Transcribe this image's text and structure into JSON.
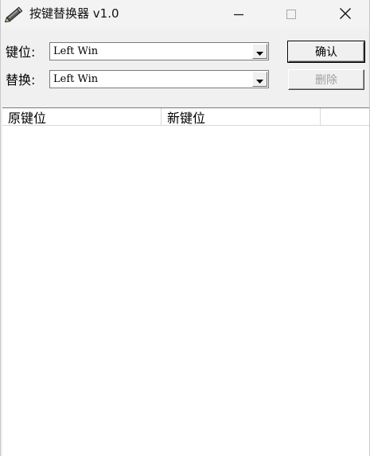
{
  "window": {
    "title": "按键替换器 v1.0",
    "icon": "pencil-icon",
    "controls": {
      "minimize": "minimize-icon",
      "maximize": "maximize-icon",
      "close": "close-icon"
    }
  },
  "form": {
    "key_label": "键位:",
    "key_value": "Left Win",
    "replace_label": "替换:",
    "replace_value": "Left Win",
    "confirm_label": "确认",
    "delete_label": "删除"
  },
  "list": {
    "columns": [
      "原键位",
      "新键位",
      ""
    ],
    "rows": []
  },
  "colors": {
    "window_bg": "#f0f0f0",
    "titlebar_bg": "#f3f3f3",
    "list_bg": "#ffffff",
    "disabled_text": "#a0a0a0"
  }
}
